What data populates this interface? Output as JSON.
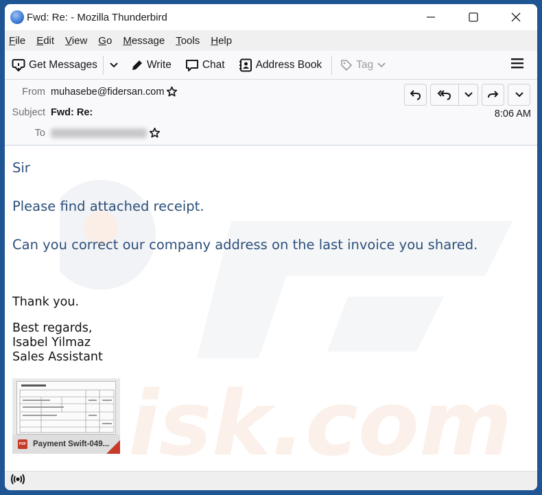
{
  "window": {
    "title": "Fwd: Re: - Mozilla Thunderbird",
    "controls": {
      "minimize": "—",
      "maximize": "☐",
      "close": "✕"
    }
  },
  "menu": [
    {
      "u": "F",
      "rest": "ile"
    },
    {
      "u": "E",
      "rest": "dit"
    },
    {
      "u": "V",
      "rest": "iew"
    },
    {
      "u": "G",
      "rest": "o"
    },
    {
      "u": "M",
      "rest": "essage"
    },
    {
      "u": "T",
      "rest": "ools"
    },
    {
      "u": "H",
      "rest": "elp"
    }
  ],
  "toolbar": {
    "get_messages": "Get Messages",
    "write": "Write",
    "chat": "Chat",
    "address_book": "Address Book",
    "tag": "Tag"
  },
  "header": {
    "from_label": "From",
    "from_value": "muhasebe@fidersan.com",
    "subject_label": "Subject",
    "subject_value": "Fwd: Re:",
    "to_label": "To",
    "time": "8:06 AM"
  },
  "message": {
    "greeting": "Sir",
    "line1": "Please find  attached receipt.",
    "line2": "Can you correct our company address on the last invoice you shared.",
    "thanks": "Thank you.",
    "signoff": "Best regards,",
    "name": "Isabel Yilmaz",
    "role": "Sales Assistant"
  },
  "attachment": {
    "badge": "PDF",
    "name": "Payment Swift-049..."
  },
  "colors": {
    "body_text_blue": "#2c4f7a",
    "window_frame": "#1f5593",
    "pdf_red": "#c73b2b"
  }
}
